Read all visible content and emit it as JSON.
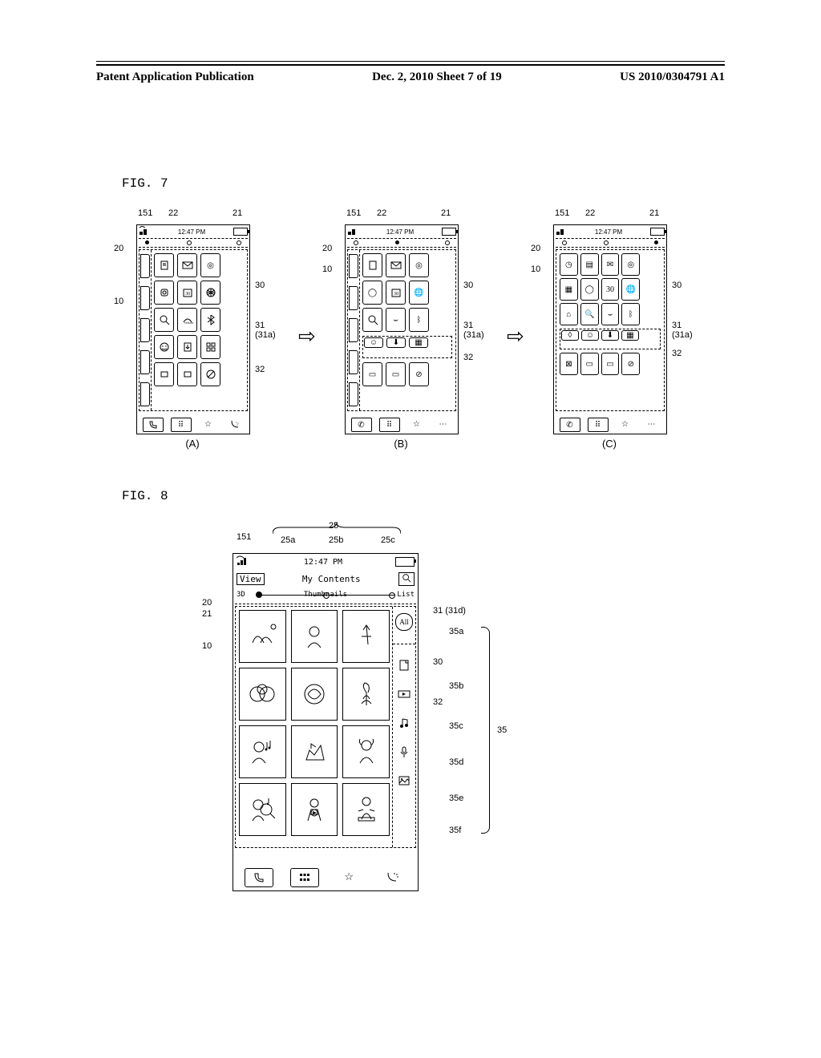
{
  "header": {
    "left": "Patent Application Publication",
    "center": "Dec. 2, 2010   Sheet 7 of 19",
    "right": "US 2010/0304791 A1"
  },
  "fig7": {
    "label": "FIG. 7",
    "status_time": "12:47 PM",
    "captions": {
      "a": "(A)",
      "b": "(B)",
      "c": "(C)"
    },
    "leads": {
      "l151": "151",
      "l22": "22",
      "l21": "21",
      "l20": "20",
      "l10": "10",
      "l30": "30",
      "l31a": "31 (31a)",
      "l32": "32"
    }
  },
  "fig8": {
    "label": "FIG. 8",
    "status_time": "12:47 PM",
    "title_btn": "View",
    "title": "My Contents",
    "slider_left": "3D",
    "slider_mid": "Thumbnails",
    "slider_right": "List",
    "right_all": "All",
    "leads": {
      "l151": "151",
      "l25": "25",
      "l25a": "25a",
      "l25b": "25b",
      "l25c": "25c",
      "l20": "20",
      "l21": "21",
      "l10": "10",
      "l31d": "31 (31d)",
      "l30": "30",
      "l32": "32",
      "l35": "35",
      "l35a": "35a",
      "l35b": "35b",
      "l35c": "35c",
      "l35d": "35d",
      "l35e": "35e",
      "l35f": "35f"
    }
  }
}
